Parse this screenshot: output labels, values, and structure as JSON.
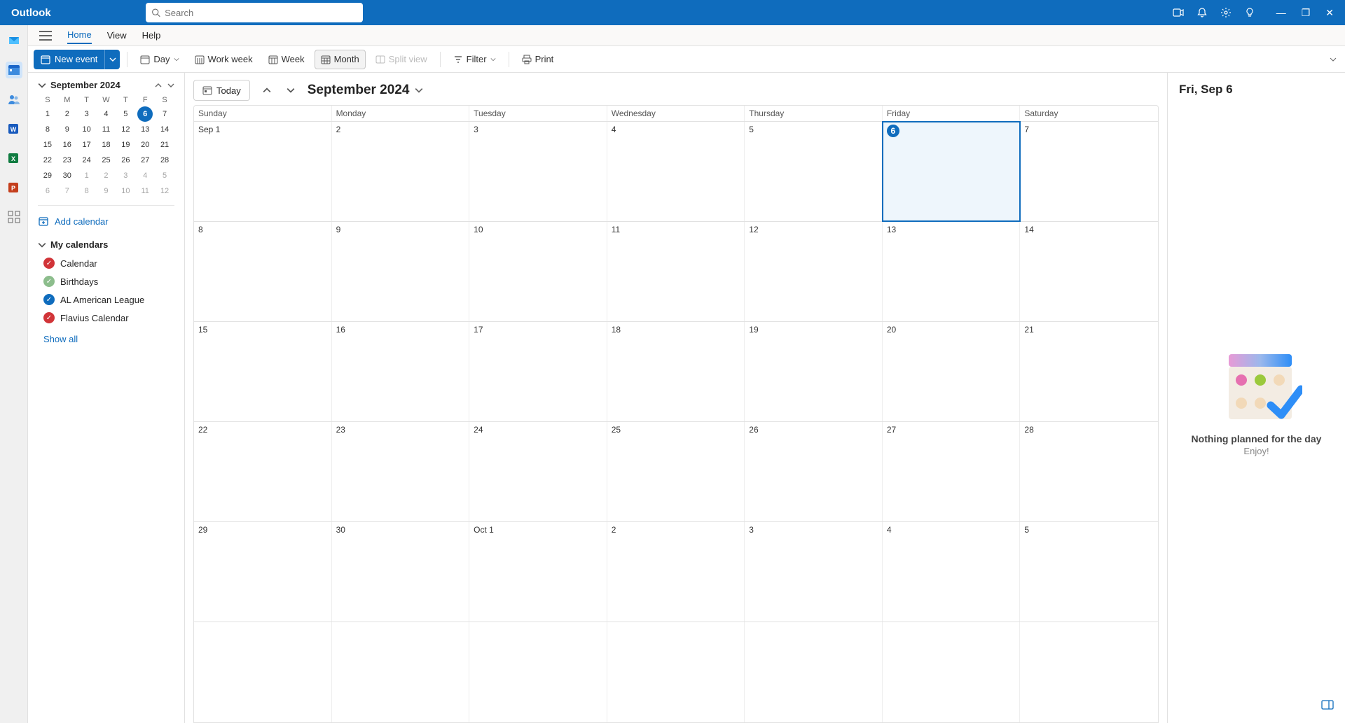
{
  "title_bar": {
    "app_name": "Outlook",
    "search_placeholder": "Search"
  },
  "tabs": {
    "home": "Home",
    "view": "View",
    "help": "Help"
  },
  "ribbon": {
    "new_event": "New event",
    "day": "Day",
    "work_week": "Work week",
    "week": "Week",
    "month": "Month",
    "split_view": "Split view",
    "filter": "Filter",
    "print": "Print"
  },
  "mini_calendar": {
    "title": "September 2024",
    "dow": [
      "S",
      "M",
      "T",
      "W",
      "T",
      "F",
      "S"
    ],
    "rows": [
      [
        {
          "n": "1"
        },
        {
          "n": "2"
        },
        {
          "n": "3"
        },
        {
          "n": "4"
        },
        {
          "n": "5"
        },
        {
          "n": "6",
          "today": true
        },
        {
          "n": "7"
        }
      ],
      [
        {
          "n": "8"
        },
        {
          "n": "9"
        },
        {
          "n": "10"
        },
        {
          "n": "11"
        },
        {
          "n": "12"
        },
        {
          "n": "13"
        },
        {
          "n": "14"
        }
      ],
      [
        {
          "n": "15"
        },
        {
          "n": "16"
        },
        {
          "n": "17"
        },
        {
          "n": "18"
        },
        {
          "n": "19"
        },
        {
          "n": "20"
        },
        {
          "n": "21"
        }
      ],
      [
        {
          "n": "22"
        },
        {
          "n": "23"
        },
        {
          "n": "24"
        },
        {
          "n": "25"
        },
        {
          "n": "26"
        },
        {
          "n": "27"
        },
        {
          "n": "28"
        }
      ],
      [
        {
          "n": "29"
        },
        {
          "n": "30"
        },
        {
          "n": "1",
          "muted": true
        },
        {
          "n": "2",
          "muted": true
        },
        {
          "n": "3",
          "muted": true
        },
        {
          "n": "4",
          "muted": true
        },
        {
          "n": "5",
          "muted": true
        }
      ],
      [
        {
          "n": "6",
          "muted": true
        },
        {
          "n": "7",
          "muted": true
        },
        {
          "n": "8",
          "muted": true
        },
        {
          "n": "9",
          "muted": true
        },
        {
          "n": "10",
          "muted": true
        },
        {
          "n": "11",
          "muted": true
        },
        {
          "n": "12",
          "muted": true
        }
      ]
    ]
  },
  "sidebar": {
    "add_calendar": "Add calendar",
    "my_calendars": "My calendars",
    "calendars": [
      {
        "name": "Calendar",
        "color": "#d13438"
      },
      {
        "name": "Birthdays",
        "color": "#8cbd8c"
      },
      {
        "name": "AL American League",
        "color": "#0f6cbd"
      },
      {
        "name": "Flavius Calendar",
        "color": "#d13438"
      }
    ],
    "show_all": "Show all"
  },
  "calendar": {
    "today_btn": "Today",
    "title": "September 2024",
    "dow": [
      "Sunday",
      "Monday",
      "Tuesday",
      "Wednesday",
      "Thursday",
      "Friday",
      "Saturday"
    ],
    "weeks": [
      [
        {
          "label": "Sep 1"
        },
        {
          "label": "2"
        },
        {
          "label": "3"
        },
        {
          "label": "4"
        },
        {
          "label": "5"
        },
        {
          "label": "6",
          "today": true
        },
        {
          "label": "7"
        }
      ],
      [
        {
          "label": "8"
        },
        {
          "label": "9"
        },
        {
          "label": "10"
        },
        {
          "label": "11"
        },
        {
          "label": "12"
        },
        {
          "label": "13"
        },
        {
          "label": "14"
        }
      ],
      [
        {
          "label": "15"
        },
        {
          "label": "16"
        },
        {
          "label": "17"
        },
        {
          "label": "18"
        },
        {
          "label": "19"
        },
        {
          "label": "20"
        },
        {
          "label": "21"
        }
      ],
      [
        {
          "label": "22"
        },
        {
          "label": "23"
        },
        {
          "label": "24"
        },
        {
          "label": "25"
        },
        {
          "label": "26"
        },
        {
          "label": "27"
        },
        {
          "label": "28"
        }
      ],
      [
        {
          "label": "29"
        },
        {
          "label": "30"
        },
        {
          "label": "Oct 1"
        },
        {
          "label": "2"
        },
        {
          "label": "3"
        },
        {
          "label": "4"
        },
        {
          "label": "5"
        }
      ],
      [
        {
          "label": ""
        },
        {
          "label": ""
        },
        {
          "label": ""
        },
        {
          "label": ""
        },
        {
          "label": ""
        },
        {
          "label": ""
        },
        {
          "label": ""
        }
      ]
    ]
  },
  "agenda": {
    "date": "Fri, Sep 6",
    "empty_title": "Nothing planned for the day",
    "empty_sub": "Enjoy!"
  }
}
